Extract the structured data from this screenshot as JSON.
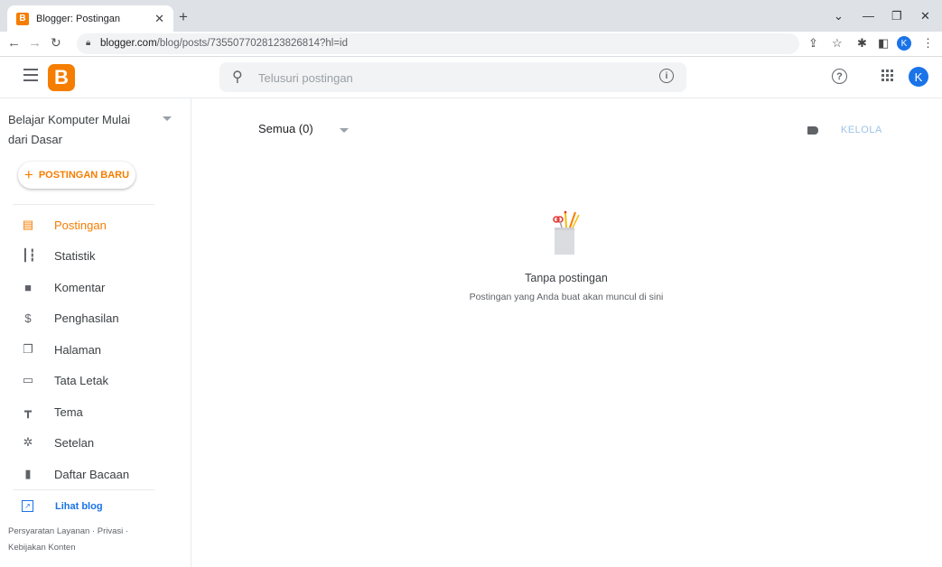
{
  "browser": {
    "tab_title": "Blogger: Postingan",
    "tab_favicon_letter": "B",
    "url_host": "blogger.com",
    "url_path": "/blog/posts/7355077028123826814?hl=id",
    "profile_initial": "K"
  },
  "appbar": {
    "logo_letter": "B",
    "search_placeholder": "Telusuri postingan",
    "avatar_initial": "K",
    "brand_color": "#f57d00"
  },
  "sidebar": {
    "blog_name": "Belajar Komputer Mulai dari Dasar",
    "new_post_label": "POSTINGAN BARU",
    "items": [
      {
        "label": "Postingan",
        "icon": "posts-icon",
        "active": true
      },
      {
        "label": "Statistik",
        "icon": "stats-icon",
        "active": false
      },
      {
        "label": "Komentar",
        "icon": "comment-icon",
        "active": false
      },
      {
        "label": "Penghasilan",
        "icon": "dollar-icon",
        "active": false
      },
      {
        "label": "Halaman",
        "icon": "pages-icon",
        "active": false
      },
      {
        "label": "Tata Letak",
        "icon": "layout-icon",
        "active": false
      },
      {
        "label": "Tema",
        "icon": "paint-roller-icon",
        "active": false
      },
      {
        "label": "Setelan",
        "icon": "gear-icon",
        "active": false
      },
      {
        "label": "Daftar Bacaan",
        "icon": "bookmark-icon",
        "active": false
      }
    ],
    "view_blog_label": "Lihat blog",
    "footer": {
      "terms": "Persyaratan Layanan",
      "privacy": "Privasi",
      "content_policy": "Kebijakan Konten"
    }
  },
  "main": {
    "filter_label": "Semua (0)",
    "manage_label": "KELOLA",
    "empty_title": "Tanpa postingan",
    "empty_subtitle": "Postingan yang Anda buat akan muncul di sini"
  }
}
